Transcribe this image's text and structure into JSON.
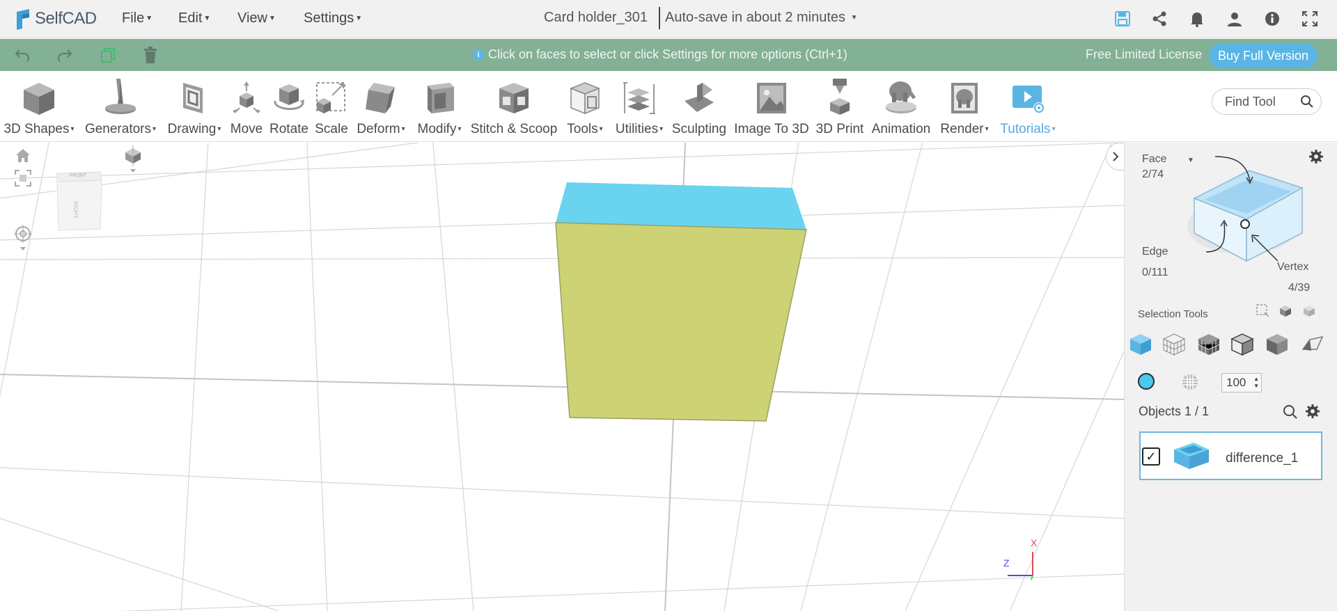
{
  "app": {
    "logo_text": "SelfCAD"
  },
  "menu": {
    "file": "File",
    "edit": "Edit",
    "view": "View",
    "settings": "Settings"
  },
  "document": {
    "title": "Card holder_301",
    "autosave": "Auto-save in about 2 minutes"
  },
  "infobar": {
    "message": "Click on faces to select or click Settings for more options (Ctrl+1)",
    "license": "Free Limited License",
    "buy_button": "Buy Full Version"
  },
  "toolbar": {
    "tools": [
      {
        "label": "3D Shapes",
        "dropdown": true
      },
      {
        "label": "Generators",
        "dropdown": true
      },
      {
        "label": "Drawing",
        "dropdown": true
      },
      {
        "label": "Move",
        "dropdown": false
      },
      {
        "label": "Rotate",
        "dropdown": false
      },
      {
        "label": "Scale",
        "dropdown": false
      },
      {
        "label": "Deform",
        "dropdown": true
      },
      {
        "label": "Modify",
        "dropdown": true
      },
      {
        "label": "Stitch & Scoop",
        "dropdown": false
      },
      {
        "label": "Tools",
        "dropdown": true
      },
      {
        "label": "Utilities",
        "dropdown": true
      },
      {
        "label": "Sculpting",
        "dropdown": false
      },
      {
        "label": "Image To 3D",
        "dropdown": false
      },
      {
        "label": "3D Print",
        "dropdown": false
      },
      {
        "label": "Animation",
        "dropdown": false
      },
      {
        "label": "Render",
        "dropdown": true
      },
      {
        "label": "Tutorials",
        "dropdown": true
      }
    ],
    "find_tool_placeholder": "Find Tool"
  },
  "viewport": {
    "nav_cube_front": "FRONT",
    "nav_cube_right": "RIGHT",
    "axis_x": "X",
    "axis_z": "Z",
    "colors": {
      "top_face": "#6ad3ef",
      "front_face": "#cdd374",
      "grid": "#d6d6d6"
    }
  },
  "panel": {
    "face_label": "Face",
    "face_count": "2/74",
    "edge_label": "Edge",
    "edge_count": "0/111",
    "vertex_label": "Vertex",
    "vertex_count": "4/39",
    "selection_tools_label": "Selection Tools",
    "opacity_value": "100",
    "objects_title": "Objects 1 / 1",
    "object_name": "difference_1",
    "accent_color": "#5ab5e5"
  }
}
